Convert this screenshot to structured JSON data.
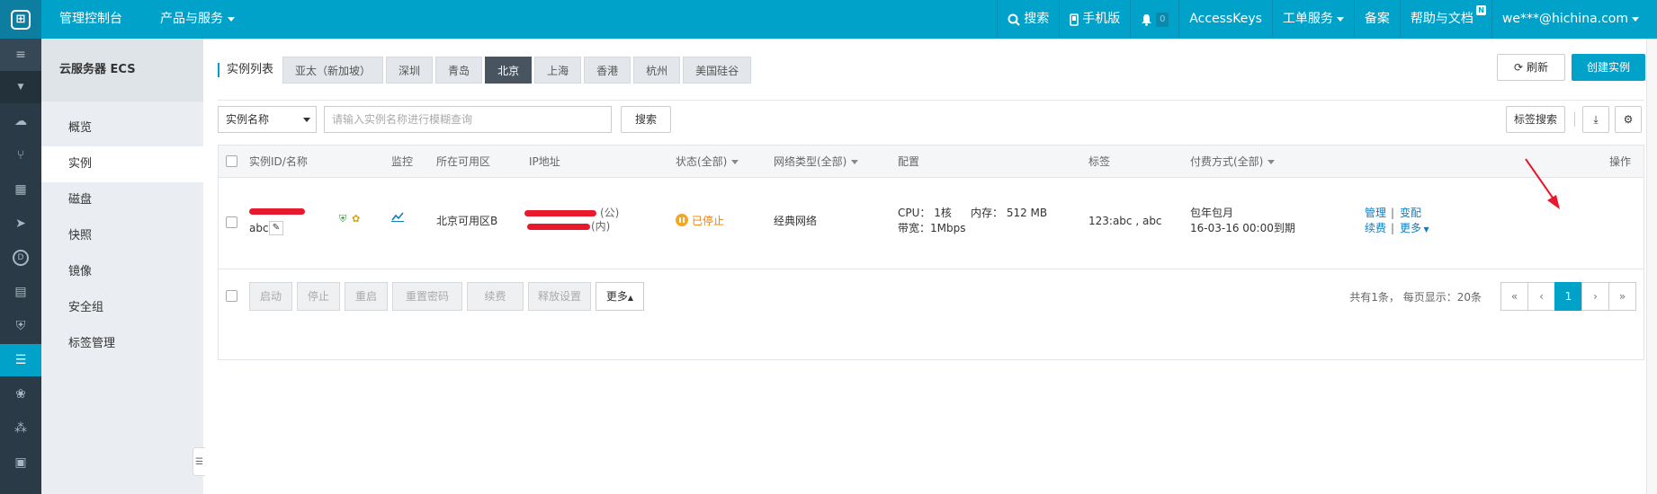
{
  "topbar": {
    "console": "管理控制台",
    "products": "产品与服务",
    "search": "搜索",
    "mobile": "手机版",
    "notify_count": "0",
    "access_keys": "AccessKeys",
    "tickets": "工单服务",
    "record": "备案",
    "help": "帮助与文档",
    "help_badge": "N",
    "account": "we***@hichina.com"
  },
  "sidebar": {
    "title": "云服务器 ECS",
    "items": [
      "概览",
      "实例",
      "磁盘",
      "快照",
      "镜像",
      "安全组",
      "标签管理"
    ],
    "active_index": 1
  },
  "regions": {
    "label": "实例列表",
    "items": [
      "亚太（新加坡）",
      "深圳",
      "青岛",
      "北京",
      "上海",
      "香港",
      "杭州",
      "美国硅谷"
    ],
    "active": "北京"
  },
  "actions": {
    "refresh": "刷新",
    "create": "创建实例"
  },
  "filter": {
    "select": "实例名称",
    "placeholder": "请输入实例名称进行模糊查询",
    "search": "搜索",
    "tag_search": "标签搜索"
  },
  "table": {
    "headers": {
      "id_name": "实例ID/名称",
      "monitor": "监控",
      "zone": "所在可用区",
      "ip": "IP地址",
      "status": "状态(全部)",
      "network": "网络类型(全部)",
      "config": "配置",
      "tags": "标签",
      "billing": "付费方式(全部)",
      "ops": "操作"
    },
    "row": {
      "name": "abc",
      "zone": "北京可用区B",
      "ip_public_suffix": "(公)",
      "ip_private_suffix": "(内)",
      "status": "已停止",
      "network": "经典网络",
      "cpu": "CPU： 1核",
      "memory": "内存： 512 MB",
      "bandwidth": "带宽：1Mbps",
      "tags": "123:abc , abc",
      "billing_type": "包年包月",
      "expire": "16-03-16 00:00到期",
      "op_manage": "管理",
      "op_change": "变配",
      "op_renew": "续费",
      "op_more": "更多"
    }
  },
  "bulk": {
    "start": "启动",
    "stop": "停止",
    "restart": "重启",
    "reset_password": "重置密码",
    "renew": "续费",
    "release": "释放设置",
    "more": "更多"
  },
  "pagination": {
    "info": "共有1条， 每页显示：20条",
    "first": "«",
    "prev": "‹",
    "current": "1",
    "next": "›",
    "last": "»"
  },
  "colors": {
    "accent": "#00a2ca",
    "rail": "#2a3a46",
    "stopped": "#f08000"
  }
}
